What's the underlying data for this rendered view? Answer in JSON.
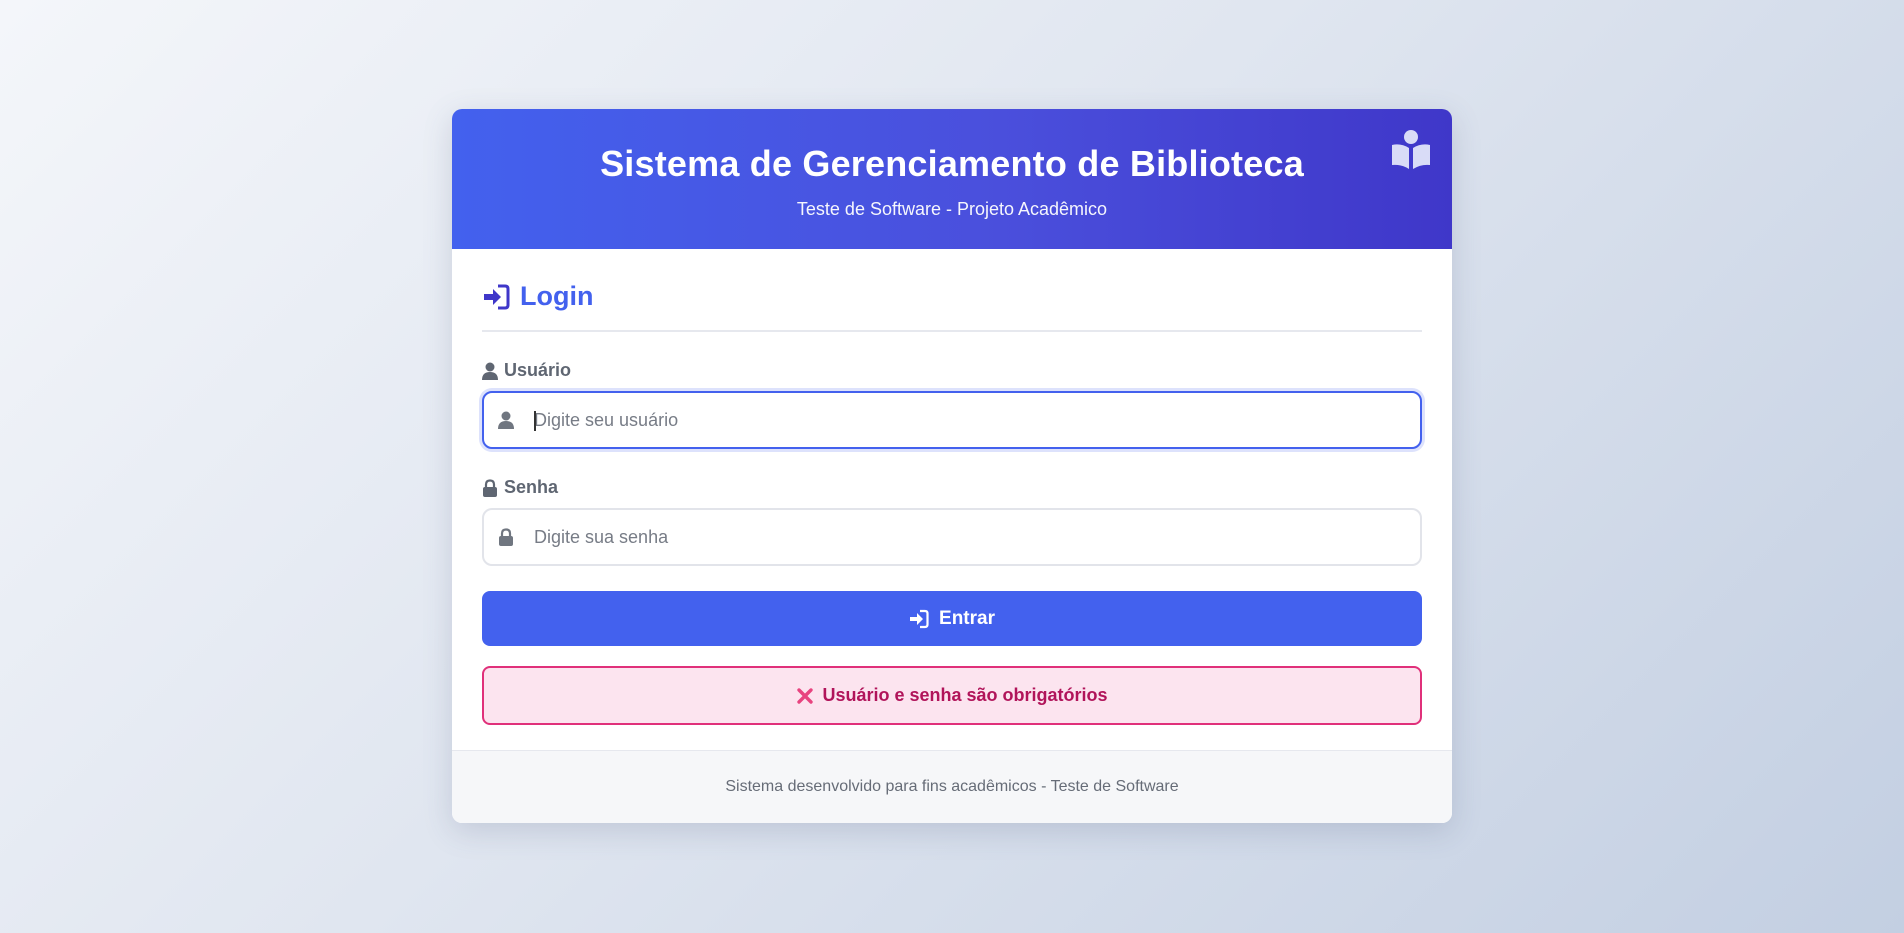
{
  "header": {
    "title": "Sistema de Gerenciamento de Biblioteca",
    "subtitle": "Teste de Software - Projeto Acadêmico",
    "icon": "book-reader-icon"
  },
  "login": {
    "title": "Login",
    "title_icon": "sign-in-icon",
    "username": {
      "label": "Usuário",
      "placeholder": "Digite seu usuário",
      "value": "",
      "icon": "user-icon"
    },
    "password": {
      "label": "Senha",
      "placeholder": "Digite sua senha",
      "value": "",
      "icon": "lock-icon"
    },
    "submit_label": "Entrar",
    "error_message": "Usuário e senha são obrigatórios",
    "error_icon": "x-mark-icon"
  },
  "footer": {
    "text": "Sistema desenvolvido para fins acadêmicos - Teste de Software"
  },
  "colors": {
    "primary": "#4361ee",
    "header_gradient_end": "#3f37c9",
    "error_border": "#e0307a",
    "error_text": "#b1145a",
    "error_bg": "#fce4ef"
  }
}
